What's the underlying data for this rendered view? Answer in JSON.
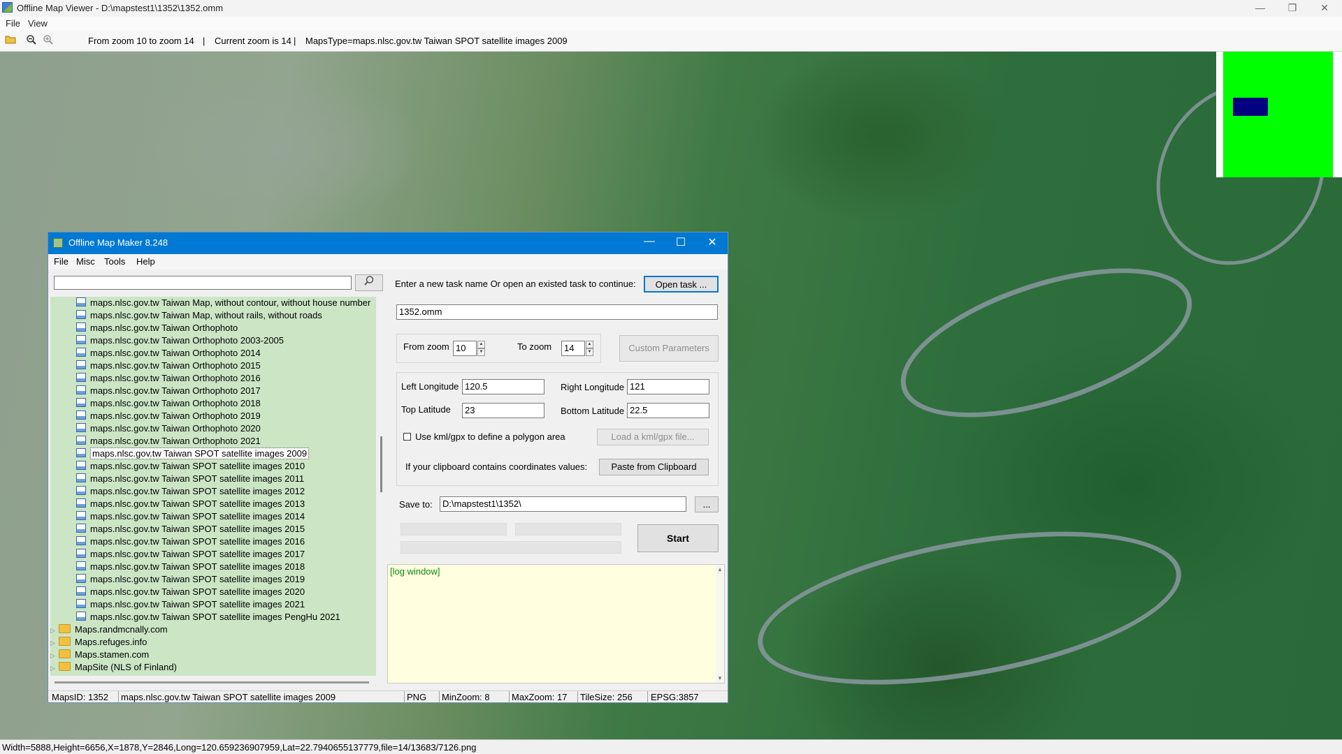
{
  "window": {
    "title": "Offline Map Viewer - D:\\mapstest1\\1352\\1352.omm",
    "menu": [
      "File",
      "View"
    ],
    "controls": {
      "minimize": "—",
      "maximize": "❐",
      "close": "✕"
    }
  },
  "toolbar": {
    "zoom_range": "From zoom 10 to zoom 14",
    "divider": "|",
    "current_zoom": "Current zoom is 14",
    "divider2": "|",
    "maps_type": "MapsType=maps.nlsc.gov.tw Taiwan SPOT satellite images 2009"
  },
  "minimap": {
    "field_color": "#00ff00",
    "viewport_color": "#000080"
  },
  "statusbar": {
    "text": "Width=5888,Height=6656,X=1878,Y=2846,Long=120.659236907959,Lat=22.7940655137779,file=14/13683/7126.png"
  },
  "dialog": {
    "title": "Offline Map Maker 8.248",
    "menu": [
      "File",
      "Misc",
      "Tools",
      "Help"
    ],
    "search": {
      "value": "",
      "icon": "magnifier-icon"
    },
    "tree": {
      "map_items": [
        "maps.nlsc.gov.tw Taiwan Map, without contour, without house number",
        "maps.nlsc.gov.tw Taiwan Map, without rails, without roads",
        "maps.nlsc.gov.tw Taiwan Orthophoto",
        "maps.nlsc.gov.tw Taiwan Orthophoto 2003-2005",
        "maps.nlsc.gov.tw Taiwan Orthophoto 2014",
        "maps.nlsc.gov.tw Taiwan Orthophoto 2015",
        "maps.nlsc.gov.tw Taiwan Orthophoto 2016",
        "maps.nlsc.gov.tw Taiwan Orthophoto 2017",
        "maps.nlsc.gov.tw Taiwan Orthophoto 2018",
        "maps.nlsc.gov.tw Taiwan Orthophoto 2019",
        "maps.nlsc.gov.tw Taiwan Orthophoto 2020",
        "maps.nlsc.gov.tw Taiwan Orthophoto 2021",
        "maps.nlsc.gov.tw Taiwan SPOT satellite images 2009",
        "maps.nlsc.gov.tw Taiwan SPOT satellite images 2010",
        "maps.nlsc.gov.tw Taiwan SPOT satellite images 2011",
        "maps.nlsc.gov.tw Taiwan SPOT satellite images 2012",
        "maps.nlsc.gov.tw Taiwan SPOT satellite images 2013",
        "maps.nlsc.gov.tw Taiwan SPOT satellite images 2014",
        "maps.nlsc.gov.tw Taiwan SPOT satellite images 2015",
        "maps.nlsc.gov.tw Taiwan SPOT satellite images 2016",
        "maps.nlsc.gov.tw Taiwan SPOT satellite images 2017",
        "maps.nlsc.gov.tw Taiwan SPOT satellite images 2018",
        "maps.nlsc.gov.tw Taiwan SPOT satellite images 2019",
        "maps.nlsc.gov.tw Taiwan SPOT satellite images 2020",
        "maps.nlsc.gov.tw Taiwan SPOT satellite images 2021",
        "maps.nlsc.gov.tw Taiwan SPOT satellite images PengHu 2021"
      ],
      "selected_item": "maps.nlsc.gov.tw Taiwan SPOT satellite images 2009",
      "folders": [
        "Maps.randmcnally.com",
        "Maps.refuges.info",
        "Maps.stamen.com",
        "MapSite (NLS of Finland)"
      ]
    },
    "task": {
      "prompt": "Enter a new task name Or open an existed task to continue:",
      "open_button": "Open task ...",
      "name_value": "1352.omm"
    },
    "zoom": {
      "from_label": "From zoom",
      "from_value": "10",
      "to_label": "To zoom",
      "to_value": "14",
      "custom_button": "Custom Parameters"
    },
    "coords": {
      "left_lon_label": "Left Longitude",
      "left_lon_value": "120.5",
      "right_lon_label": "Right Longitude",
      "right_lon_value": "121",
      "top_lat_label": "Top Latitude",
      "top_lat_value": "23",
      "bottom_lat_label": "Bottom Latitude",
      "bottom_lat_value": "22.5",
      "kml_label": "Use kml/gpx to define a polygon area",
      "kml_checked": false,
      "kml_button": "Load a kml/gpx file...",
      "clipboard_label": "If your clipboard contains coordinates values:",
      "clipboard_button": "Paste from Clipboard"
    },
    "save": {
      "label": "Save to:",
      "value": "D:\\mapstest1\\1352\\",
      "browse": "...",
      "start": "Start"
    },
    "log": {
      "text": "[log window]"
    },
    "status": {
      "maps_id": "MapsID: 1352",
      "maps_name": "maps.nlsc.gov.tw Taiwan SPOT satellite images 2009",
      "format": "PNG",
      "min_zoom": "MinZoom: 8",
      "max_zoom": "MaxZoom: 17",
      "tile_size": "TileSize: 256",
      "epsg": "EPSG:3857"
    }
  }
}
